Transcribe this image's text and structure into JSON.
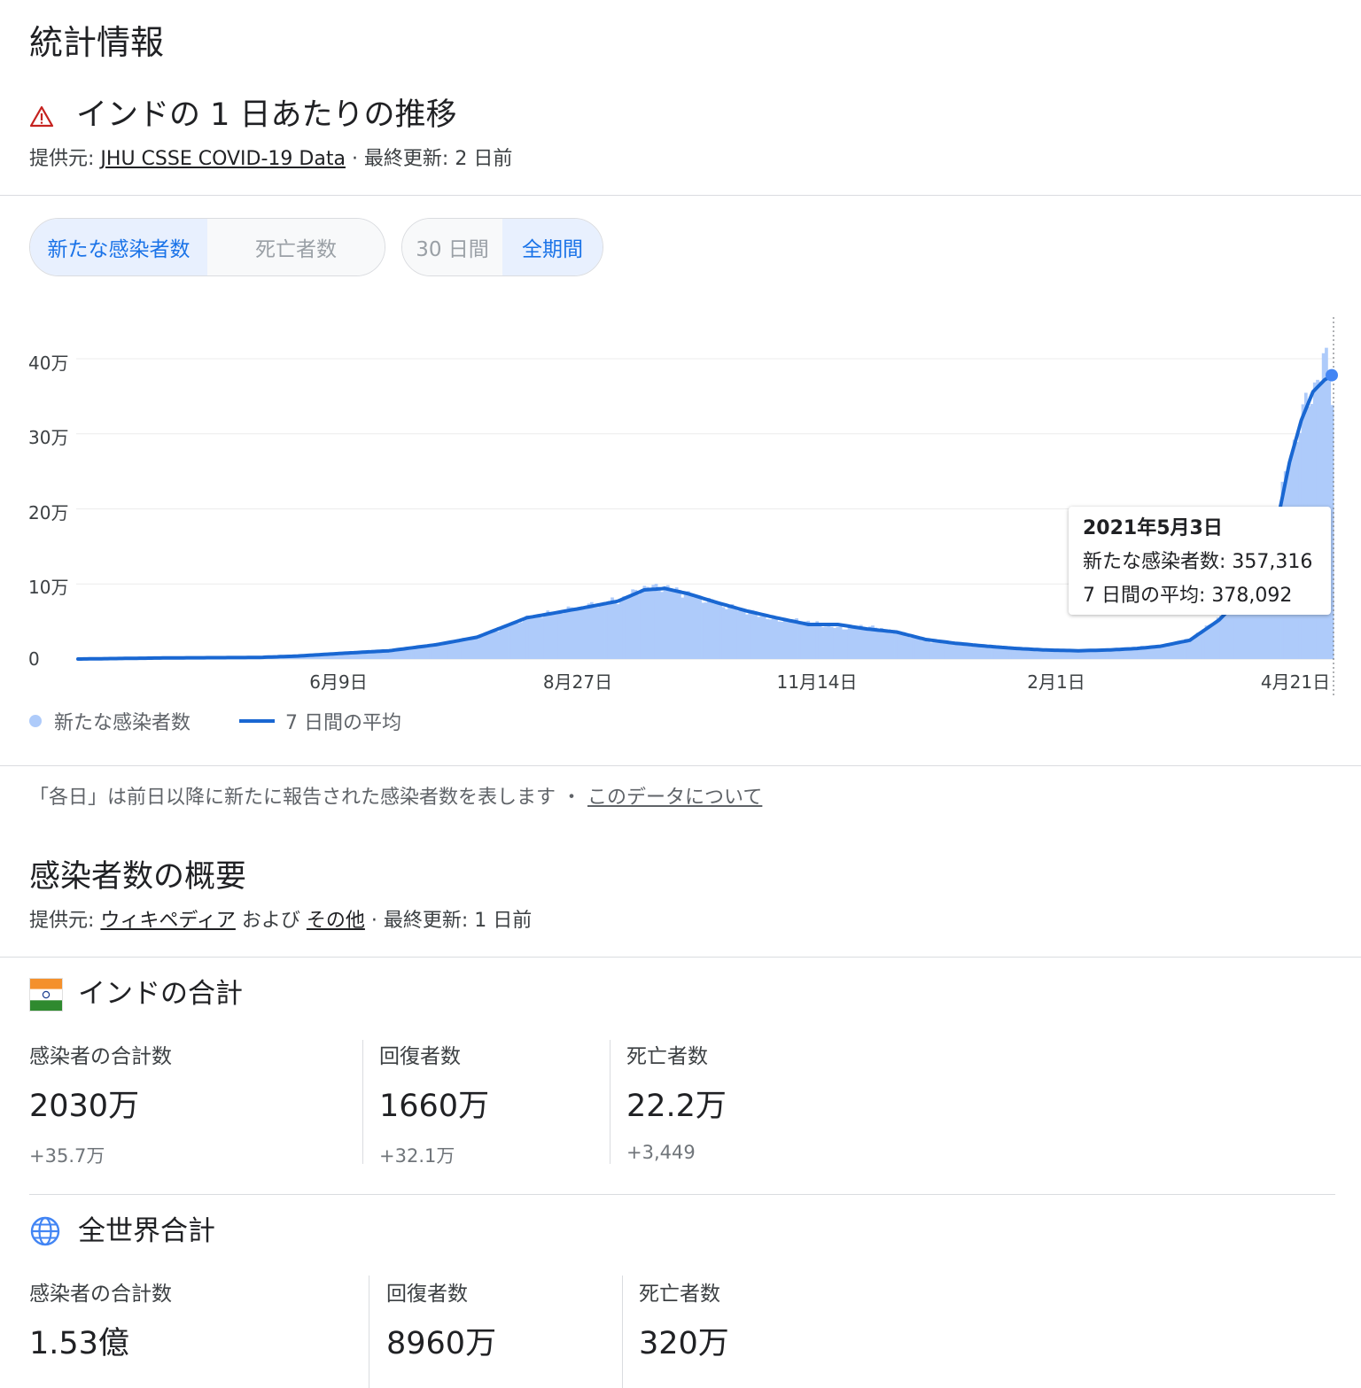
{
  "header": {
    "title": "統計情報",
    "subtitle": "インドの 1 日あたりの推移",
    "source_prefix": "提供元: ",
    "source_link": "JHU CSSE COVID-19 Data",
    "source_suffix": " · 最終更新: 2 日前"
  },
  "toggles": {
    "metric": [
      {
        "label": "新たな感染者数",
        "selected": true
      },
      {
        "label": "死亡者数",
        "selected": false
      }
    ],
    "range": [
      {
        "label": "30 日間",
        "selected": false
      },
      {
        "label": "全期間",
        "selected": true
      }
    ]
  },
  "chart_data": {
    "type": "area",
    "y_axis": {
      "ticks": [
        "0",
        "10万",
        "20万",
        "30万",
        "40万"
      ],
      "tick_values": [
        0,
        100000,
        200000,
        300000,
        400000
      ],
      "ylim": [
        0,
        400000
      ]
    },
    "x_axis": {
      "tick_labels": [
        "6月9日",
        "8月27日",
        "11月14日",
        "2月1日",
        "4月21日"
      ],
      "tick_dates": [
        "2020-06-09",
        "2020-08-27",
        "2020-11-14",
        "2021-02-01",
        "2021-04-21"
      ],
      "range": [
        "2020-03-01",
        "2021-05-03"
      ]
    },
    "grid": true,
    "series": [
      {
        "name": "新たな感染者数",
        "kind": "bars",
        "color": "#aecbfa",
        "x": [
          "2020-03-01",
          "2020-04-01",
          "2020-05-01",
          "2020-05-15",
          "2020-06-01",
          "2020-06-15",
          "2020-07-01",
          "2020-07-15",
          "2020-08-01",
          "2020-08-10",
          "2020-08-20",
          "2020-09-01",
          "2020-09-10",
          "2020-09-17",
          "2020-09-25",
          "2020-10-05",
          "2020-10-15",
          "2020-10-25",
          "2020-11-05",
          "2020-11-15",
          "2020-11-25",
          "2020-12-05",
          "2020-12-15",
          "2020-12-25",
          "2021-01-05",
          "2021-01-15",
          "2021-01-25",
          "2021-02-05",
          "2021-02-15",
          "2021-02-25",
          "2021-03-05",
          "2021-03-15",
          "2021-03-25",
          "2021-04-01",
          "2021-04-07",
          "2021-04-14",
          "2021-04-18",
          "2021-04-22",
          "2021-04-26",
          "2021-04-30",
          "2021-05-03"
        ],
        "y": [
          0,
          1500,
          2000,
          4000,
          8000,
          11000,
          19000,
          29000,
          55000,
          62000,
          69000,
          78000,
          95000,
          96000,
          86000,
          74000,
          63000,
          52000,
          50000,
          41000,
          44000,
          36000,
          24000,
          20000,
          18000,
          15000,
          13000,
          12000,
          11000,
          16000,
          17000,
          26000,
          53000,
          81000,
          115000,
          184000,
          260000,
          315000,
          352000,
          400000,
          357316
        ]
      },
      {
        "name": "7 日間の平均",
        "kind": "line",
        "color": "#1967d2",
        "x": [
          "2020-03-01",
          "2020-04-01",
          "2020-05-01",
          "2020-05-15",
          "2020-06-01",
          "2020-06-15",
          "2020-07-01",
          "2020-07-15",
          "2020-08-01",
          "2020-08-10",
          "2020-08-20",
          "2020-09-01",
          "2020-09-10",
          "2020-09-17",
          "2020-09-25",
          "2020-10-05",
          "2020-10-15",
          "2020-10-25",
          "2020-11-05",
          "2020-11-15",
          "2020-11-25",
          "2020-12-05",
          "2020-12-15",
          "2020-12-25",
          "2021-01-05",
          "2021-01-15",
          "2021-01-25",
          "2021-02-05",
          "2021-02-15",
          "2021-02-25",
          "2021-03-05",
          "2021-03-15",
          "2021-03-25",
          "2021-04-01",
          "2021-04-07",
          "2021-04-14",
          "2021-04-18",
          "2021-04-22",
          "2021-04-26",
          "2021-04-30",
          "2021-05-03"
        ],
        "y": [
          0,
          1500,
          2000,
          4000,
          8000,
          11000,
          19000,
          29000,
          55000,
          61000,
          68000,
          77000,
          92000,
          94000,
          87000,
          75000,
          64000,
          55000,
          46000,
          46000,
          40000,
          36000,
          26000,
          21000,
          17000,
          14000,
          12000,
          11000,
          12000,
          14000,
          17000,
          25000,
          52000,
          80000,
          115000,
          186000,
          262000,
          318000,
          356000,
          372000,
          378092
        ]
      }
    ],
    "tooltip": {
      "date": "2021年5月3日",
      "line1": "新たな感染者数: 357,316",
      "line2": "7 日間の平均: 378,092"
    },
    "legend": [
      {
        "label": "新たな感染者数",
        "kind": "dot",
        "color": "#aecbfa"
      },
      {
        "label": "7 日間の平均",
        "kind": "line",
        "color": "#1967d2"
      }
    ],
    "legend_position": "bottom-left"
  },
  "note": {
    "text": "「各日」は前日以降に新たに報告された感染者数を表します ・ ",
    "link": "このデータについて"
  },
  "overview": {
    "title": "感染者数の概要",
    "source_prefix": "提供元: ",
    "source_link1": "ウィキペディア",
    "source_mid": " および ",
    "source_link2": "その他",
    "source_suffix": " · 最終更新: 1 日前"
  },
  "india": {
    "title": "インドの合計",
    "stats": [
      {
        "label": "感染者の合計数",
        "value": "2030万",
        "delta": "+35.7万"
      },
      {
        "label": "回復者数",
        "value": "1660万",
        "delta": "+32.1万"
      },
      {
        "label": "死亡者数",
        "value": "22.2万",
        "delta": "+3,449"
      }
    ]
  },
  "world": {
    "title": "全世界合計",
    "stats": [
      {
        "label": "感染者の合計数",
        "value": "1.53億"
      },
      {
        "label": "回復者数",
        "value": "8960万"
      },
      {
        "label": "死亡者数",
        "value": "320万"
      }
    ]
  },
  "colors": {
    "accent": "#1a73e8",
    "bar": "#aecbfa",
    "line": "#1967d2",
    "warning": "#c5221f"
  }
}
